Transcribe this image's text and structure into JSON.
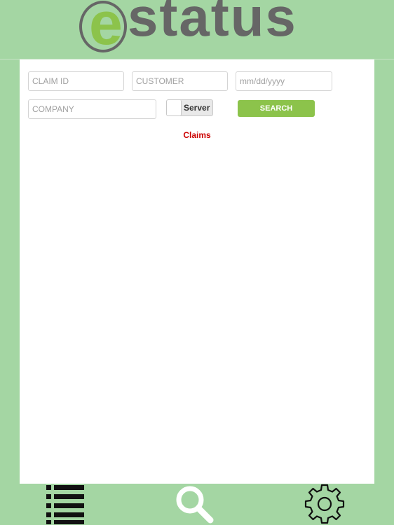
{
  "header": {
    "logo_first_letter": "e",
    "logo_rest": "status"
  },
  "form": {
    "claim_id_placeholder": "CLAIM ID",
    "customer_placeholder": "CUSTOMER",
    "date_placeholder": "mm/dd/yyyy",
    "company_placeholder": "COMPANY",
    "server_toggle_label": "Server",
    "server_toggle_on": false,
    "search_button_label": "SEARCH"
  },
  "results": {
    "section_label": "Claims"
  },
  "tabbar": {
    "items": [
      {
        "icon": "list-icon"
      },
      {
        "icon": "search-icon"
      },
      {
        "icon": "gear-icon"
      }
    ]
  },
  "colors": {
    "background_green": "#a4d6a3",
    "accent_green": "#8cc34b",
    "logo_gray": "#666666",
    "claims_red": "#cc0000"
  }
}
